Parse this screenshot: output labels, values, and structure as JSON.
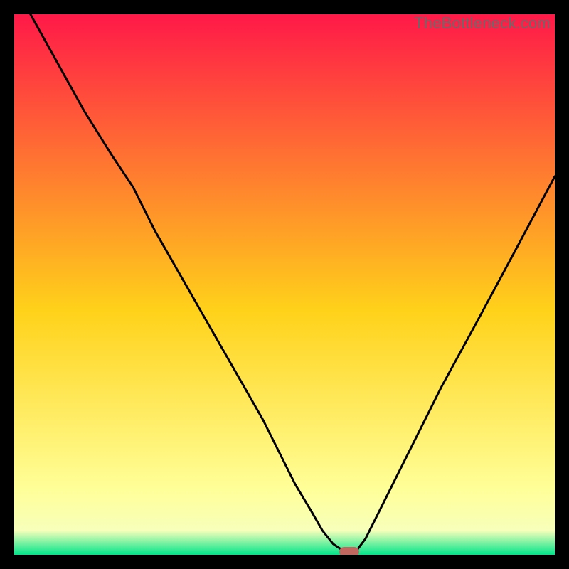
{
  "watermark": "TheBottleneck.com",
  "colors": {
    "frame": "#000000",
    "watermark": "#6a6a6a",
    "curve": "#000000",
    "marker": "#c1675f",
    "gradient_top": "#ff1948",
    "gradient_mid": "#ffd21a",
    "gradient_low": "#ffff99",
    "gradient_bottom": "#00e58a"
  },
  "chart_data": {
    "type": "line",
    "title": "",
    "xlabel": "",
    "ylabel": "",
    "xlim": [
      0,
      100
    ],
    "ylim": [
      0,
      100
    ],
    "x": [
      3,
      8,
      13,
      18,
      22,
      26,
      30,
      34,
      38,
      42,
      46,
      49,
      52,
      55,
      57,
      59,
      60.5,
      61.5,
      62.5,
      63.5,
      65,
      67,
      70,
      74,
      79,
      85,
      92,
      100
    ],
    "values": [
      100,
      91,
      82,
      74,
      68,
      60,
      53,
      46,
      39,
      32,
      25,
      19,
      13,
      8,
      4.5,
      2,
      1,
      0.5,
      0.5,
      1,
      3,
      7,
      13,
      21,
      31,
      42,
      55,
      70
    ],
    "minimum_x": 62,
    "minimum_y": 0.5,
    "left_branch_kink": {
      "x": 22,
      "y": 68
    }
  }
}
